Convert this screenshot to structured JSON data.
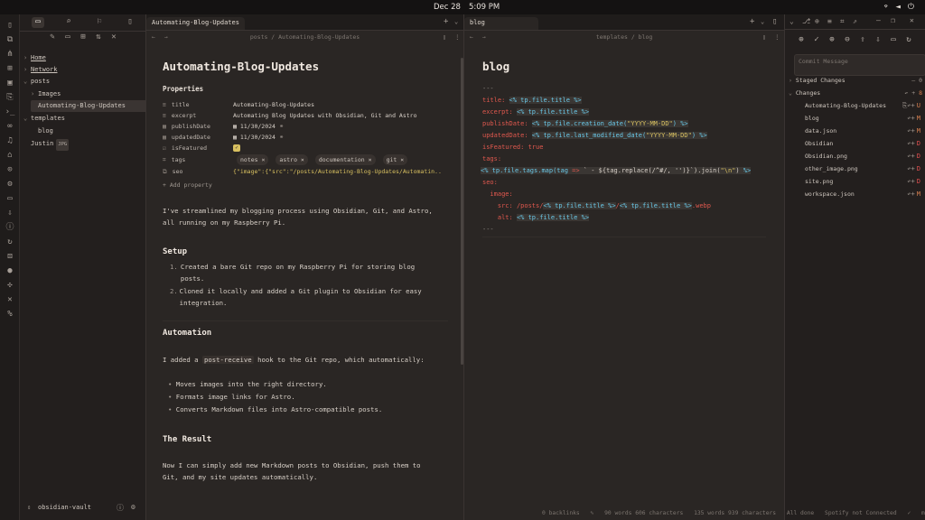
{
  "topbar": {
    "date": "Dec 28",
    "time": "5:09 PM"
  },
  "left_sidebar": {
    "tree": [
      {
        "label": "Home",
        "indent": 0,
        "expanded": false
      },
      {
        "label": "Network",
        "indent": 0,
        "expanded": false
      },
      {
        "label": "posts",
        "indent": 0,
        "expanded": true
      },
      {
        "label": "Images",
        "indent": 1,
        "expanded": false
      },
      {
        "label": "Automating-Blog-Updates",
        "indent": 1,
        "selected": true
      },
      {
        "label": "templates",
        "indent": 0,
        "expanded": true
      },
      {
        "label": "blog",
        "indent": 1
      },
      {
        "label": "Justin",
        "indent": 0,
        "badge": "JPG"
      }
    ],
    "vault_name": "obsidian-vault"
  },
  "left_editor": {
    "tab_title": "Automating-Blog-Updates",
    "breadcrumb": "posts / Automating-Blog-Updates",
    "title": "Automating-Blog-Updates",
    "properties_heading": "Properties",
    "properties": [
      {
        "key": "title",
        "value": "Automating-Blog-Updates"
      },
      {
        "key": "excerpt",
        "value": "Automating Blog Updates with Obsidian, Git and Astro"
      },
      {
        "key": "publishDate",
        "value": "11/30/2024"
      },
      {
        "key": "updatedDate",
        "value": "11/30/2024"
      },
      {
        "key": "isFeatured",
        "value": "checked"
      },
      {
        "key": "tags",
        "tags": [
          "notes",
          "astro",
          "documentation",
          "git"
        ]
      },
      {
        "key": "seo",
        "value": "{\"image\":{\"src\":\"/posts/Automating-Blog-Updates/Automatin..."
      }
    ],
    "add_property": "+ Add property",
    "intro": "I've streamlined my blogging process using Obsidian, Git, and Astro, all running on my Raspberry Pi.",
    "setup_heading": "Setup",
    "setup_items": [
      "Created a bare Git repo on my Raspberry Pi for storing blog posts.",
      "Cloned it locally and added a Git plugin to Obsidian for easy integration."
    ],
    "automation_heading": "Automation",
    "automation_intro_a": "I added a",
    "automation_code": "post-receive",
    "automation_intro_b": "hook to the Git repo, which automatically:",
    "automation_items": [
      "Moves images into the right directory.",
      "Formats image links for Astro.",
      "Converts Markdown files into Astro-compatible posts."
    ],
    "result_heading": "The Result",
    "result_text": "Now I can simply add new Markdown posts to Obsidian, push them to Git, and my site updates automatically."
  },
  "right_editor": {
    "tab_title": "blog",
    "breadcrumb": "templates / blog",
    "title": "blog",
    "code_lines": [
      "---",
      "title: <% tp.file.title %>",
      "excerpt: <% tp.file.title %>",
      "publishDate: <% tp.file.creation_date(\"YYYY-MM-DD\") %>",
      "updatedDate: <% tp.file.last_modified_date(\"YYYY-MM-DD\") %>",
      "isFeatured: true",
      "tags:",
      "<% tp.file.tags.map(tag => `  - ${tag.replace(/^#/, '')}`).join(\"\\n\") %>",
      "seo:",
      "  image:",
      "    src: /posts/<% tp.file.title %>/<% tp.file.title %>.webp",
      "    alt: <% tp.file.title %>",
      "---"
    ]
  },
  "git_panel": {
    "commit_placeholder": "Commit Message",
    "staged_label": "Staged Changes",
    "staged_count": "0",
    "changes_label": "Changes",
    "changes": [
      {
        "name": "Automating-Blog-Updates",
        "status": "U"
      },
      {
        "name": "blog",
        "status": "M"
      },
      {
        "name": "data.json",
        "status": "M"
      },
      {
        "name": "Obsidian",
        "status": "D"
      },
      {
        "name": "Obsidian.png",
        "status": "D"
      },
      {
        "name": "other_image.png",
        "status": "D"
      },
      {
        "name": "site.png",
        "status": "D"
      },
      {
        "name": "workspace.json",
        "status": "M"
      }
    ]
  },
  "status_bar": {
    "backlinks": "0 backlinks",
    "words_left": "90 words 606 characters",
    "words_right": "135 words 939 characters",
    "sync": "All done",
    "spotify": "Spotify not Connected",
    "git": "main"
  },
  "colors": {
    "accent_red": "#e0584e",
    "accent_cyan": "#69c8e8",
    "accent_yellow": "#d8c060",
    "checkbox": "#d8c060"
  }
}
